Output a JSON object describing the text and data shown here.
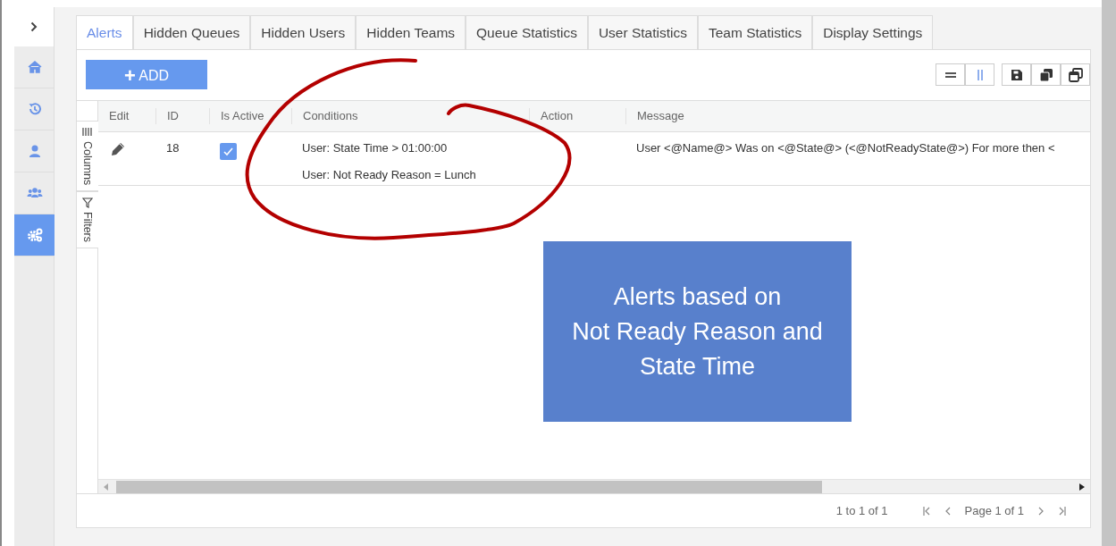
{
  "sidebar": {
    "items": [
      {
        "kind": "home",
        "selected": false
      },
      {
        "kind": "history",
        "selected": false
      },
      {
        "kind": "user",
        "selected": false
      },
      {
        "kind": "team",
        "selected": false
      },
      {
        "kind": "settings",
        "selected": true
      }
    ]
  },
  "tabs": [
    {
      "label": "Alerts",
      "selected": true
    },
    {
      "label": "Hidden Queues",
      "selected": false
    },
    {
      "label": "Hidden Users",
      "selected": false
    },
    {
      "label": "Hidden Teams",
      "selected": false
    },
    {
      "label": "Queue Statistics",
      "selected": false
    },
    {
      "label": "User Statistics",
      "selected": false
    },
    {
      "label": "Team Statistics",
      "selected": false
    },
    {
      "label": "Display Settings",
      "selected": false
    }
  ],
  "add_button": {
    "icon": "+",
    "label": "ADD"
  },
  "toolbar": {
    "view_toggles": [
      {
        "kind": "rows",
        "selected": false
      },
      {
        "kind": "columns",
        "selected": true
      }
    ],
    "actions": [
      {
        "kind": "save"
      },
      {
        "kind": "windows"
      },
      {
        "kind": "window"
      }
    ]
  },
  "side_panel": [
    {
      "kind": "columns",
      "label": "Columns"
    },
    {
      "kind": "filters",
      "label": "Filters"
    }
  ],
  "table": {
    "columns": [
      "Edit",
      "ID",
      "Is Active",
      "Conditions",
      "Action",
      "Message"
    ],
    "rows": [
      {
        "id": "18",
        "is_active": true,
        "conditions": [
          "User: State Time > 01:00:00",
          "User: Not Ready Reason = Lunch"
        ],
        "message": "User <@Name@> Was on <@State@> (<@NotReadyState@>) For more then <"
      }
    ]
  },
  "pagination": {
    "summary": "1 to 1 of 1",
    "page": "Page 1 of 1"
  },
  "callout": {
    "lines": [
      "Alerts based on",
      "Not Ready Reason and",
      "State Time"
    ]
  }
}
